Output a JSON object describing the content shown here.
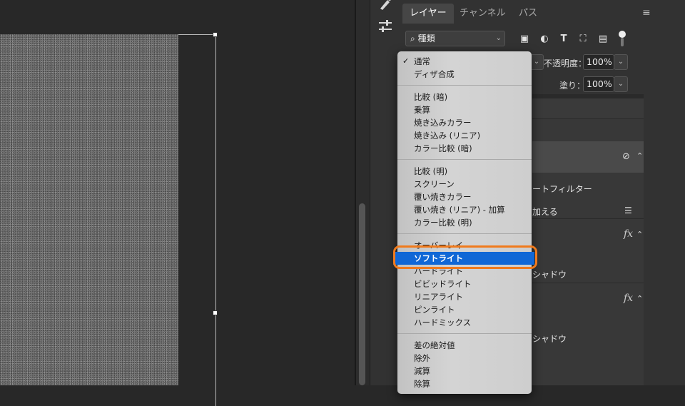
{
  "tabs": [
    "レイヤー",
    "チャンネル",
    "パス"
  ],
  "filter": {
    "selected": "種類",
    "icons": [
      "image-icon",
      "adjustment-icon",
      "type-icon",
      "shape-icon",
      "smart-object-icon"
    ]
  },
  "opacity": {
    "label": "不透明度：",
    "value": "100%"
  },
  "fill": {
    "label": "塗り：",
    "value": "100%"
  },
  "layer_rows": {
    "smart_filter": "ートフィルター",
    "add": "加える",
    "shadow_1": "シャドウ",
    "shadow_2": "シャドウ"
  },
  "fx_label": "fx",
  "blend_menu": {
    "checked": "通常",
    "selected": "ソフトライト",
    "groups": [
      [
        "通常",
        "ディザ合成"
      ],
      [
        "比較 (暗)",
        "乗算",
        "焼き込みカラー",
        "焼き込み (リニア)",
        "カラー比較 (暗)"
      ],
      [
        "比較 (明)",
        "スクリーン",
        "覆い焼きカラー",
        "覆い焼き (リニア) - 加算",
        "カラー比較 (明)"
      ],
      [
        "オーバーレイ",
        "ソフトライト",
        "ハードライト",
        "ビビッドライト",
        "リニアライト",
        "ピンライト",
        "ハードミックス"
      ],
      [
        "差の絶対値",
        "除外",
        "減算",
        "除算"
      ]
    ]
  },
  "colors": {
    "highlight": "#1067d6",
    "annotation": "#f07a1c"
  }
}
